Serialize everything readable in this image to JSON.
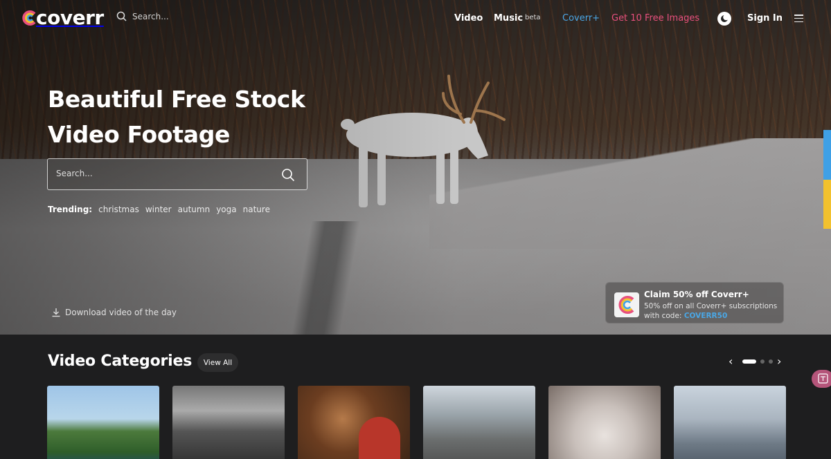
{
  "brand": {
    "logo_text": "coverr"
  },
  "nav": {
    "search_placeholder": "Search...",
    "links": {
      "video": "Video",
      "music": "Music",
      "music_badge": "beta",
      "coverr_plus": "Coverr+",
      "free_images": "Get 10 Free Images",
      "sign_in": "Sign In"
    },
    "colors": {
      "coverr_plus": "#4aa7e6",
      "free_images": "#e8507e"
    }
  },
  "hero": {
    "title_line1": "Beautiful Free Stock",
    "title_line2": "Video Footage",
    "search_placeholder": "Search...",
    "trending_label": "Trending:",
    "trending": [
      "christmas",
      "winter",
      "autumn",
      "yoga",
      "nature"
    ],
    "download_label": "Download video of the day"
  },
  "promo": {
    "title": "Claim 50% off Coverr+",
    "desc": "50% off on all Coverr+ subscriptions with code:",
    "code": "COVERR50"
  },
  "categories": {
    "title": "Video Categories",
    "view_all": "View All",
    "carousel_page": 1,
    "carousel_pages": 3
  }
}
